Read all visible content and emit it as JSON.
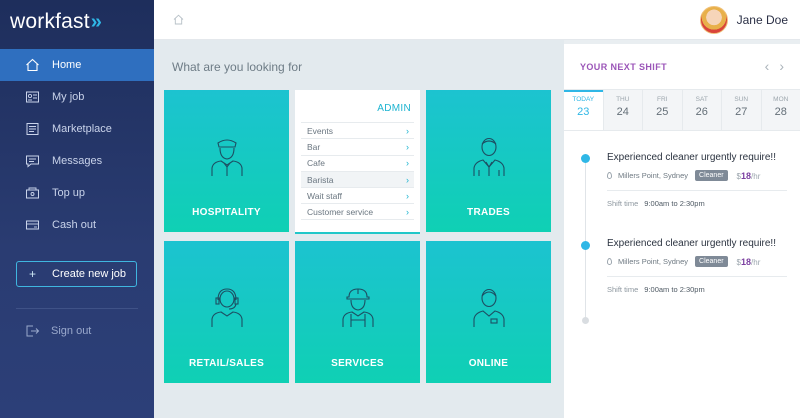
{
  "app": {
    "logo_text": "workfast",
    "logo_mark": "»"
  },
  "sidebar": {
    "items": [
      {
        "label": "Home",
        "icon": "home-icon",
        "active": true
      },
      {
        "label": "My job",
        "icon": "my-job-icon"
      },
      {
        "label": "Marketplace",
        "icon": "marketplace-icon"
      },
      {
        "label": "Messages",
        "icon": "messages-icon"
      },
      {
        "label": "Top up",
        "icon": "top-up-icon"
      },
      {
        "label": "Cash out",
        "icon": "cash-out-icon"
      }
    ],
    "create_job": {
      "plus": "+",
      "label": "Create new job"
    },
    "sign_out": "Sign out"
  },
  "topbar": {
    "user_name": "Jane Doe"
  },
  "main": {
    "title": "What are you looking for",
    "tiles": {
      "hospitality": "HOSPITALITY",
      "trades": "TRADES",
      "retail": "RETAIL/SALES",
      "services": "SERVICES",
      "online": "ONLINE"
    },
    "admin": {
      "title": "ADMIN",
      "items": [
        "Events",
        "Bar",
        "Cafe",
        "Barista",
        "Wait staff",
        "Customer service"
      ],
      "arrow": "›"
    }
  },
  "panel": {
    "title": "YOUR NEXT SHIFT",
    "prev": "‹",
    "next": "›",
    "days": [
      {
        "name": "TODAY",
        "date": "23"
      },
      {
        "name": "THU",
        "date": "24"
      },
      {
        "name": "FRI",
        "date": "25"
      },
      {
        "name": "SAT",
        "date": "26"
      },
      {
        "name": "SUN",
        "date": "27"
      },
      {
        "name": "MON",
        "date": "28"
      }
    ],
    "shifts": [
      {
        "title": "Experienced cleaner urgently require!!",
        "location": "Millers Point, Sydney",
        "badge": "Cleaner",
        "rate_symbol": "$",
        "rate_value": "18",
        "rate_unit": "/hr",
        "time_label": "Shift time",
        "time_value": "9:00am to 2:30pm"
      },
      {
        "title": "Experienced cleaner urgently require!!",
        "location": "Millers Point, Sydney",
        "badge": "Cleaner",
        "rate_symbol": "$",
        "rate_value": "18",
        "rate_unit": "/hr",
        "time_label": "Shift time",
        "time_value": "9:00am to 2:30pm"
      }
    ]
  },
  "colors": {
    "sidebar_bg": "#1e2e5c",
    "active": "#2f6fbf",
    "accent": "#2fb7e6",
    "tile_top": "#1cc3d0",
    "tile_bottom": "#0fd0b4",
    "purple": "#9b55b8"
  }
}
